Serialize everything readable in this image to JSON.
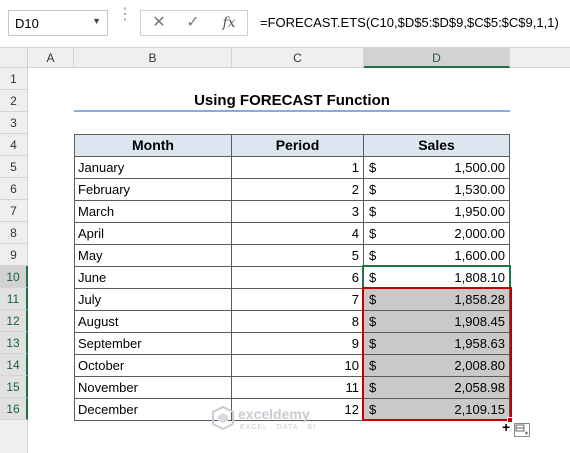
{
  "formula_bar": {
    "name_box": "D10",
    "cancel_icon": "✕",
    "enter_icon": "✓",
    "fx_label": "fx",
    "formula": "=FORECAST.ETS(C10,$D$5:$D$9,$C$5:$C$9,1,1)"
  },
  "columns": [
    "A",
    "B",
    "C",
    "D"
  ],
  "rows": [
    "1",
    "2",
    "3",
    "4",
    "5",
    "6",
    "7",
    "8",
    "9",
    "10",
    "11",
    "12",
    "13",
    "14",
    "15",
    "16"
  ],
  "sheet": {
    "title": "Using FORECAST Function",
    "headers": {
      "month": "Month",
      "period": "Period",
      "sales": "Sales"
    },
    "currency_symbol": "$",
    "data": [
      {
        "month": "January",
        "period": "1",
        "sales": "1,500.00"
      },
      {
        "month": "February",
        "period": "2",
        "sales": "1,530.00"
      },
      {
        "month": "March",
        "period": "3",
        "sales": "1,950.00"
      },
      {
        "month": "April",
        "period": "4",
        "sales": "2,000.00"
      },
      {
        "month": "May",
        "period": "5",
        "sales": "1,600.00"
      },
      {
        "month": "June",
        "period": "6",
        "sales": "1,808.10"
      },
      {
        "month": "July",
        "period": "7",
        "sales": "1,858.28"
      },
      {
        "month": "August",
        "period": "8",
        "sales": "1,908.45"
      },
      {
        "month": "September",
        "period": "9",
        "sales": "1,958.63"
      },
      {
        "month": "October",
        "period": "10",
        "sales": "2,008.80"
      },
      {
        "month": "November",
        "period": "11",
        "sales": "2,058.98"
      },
      {
        "month": "December",
        "period": "12",
        "sales": "2,109.15"
      }
    ]
  },
  "watermark": {
    "name": "exceldemy",
    "tagline": "EXCEL · DATA · BI"
  },
  "colors": {
    "header_fill": "#dce6f1",
    "selection_border": "#c00000",
    "active_border": "#217346"
  }
}
